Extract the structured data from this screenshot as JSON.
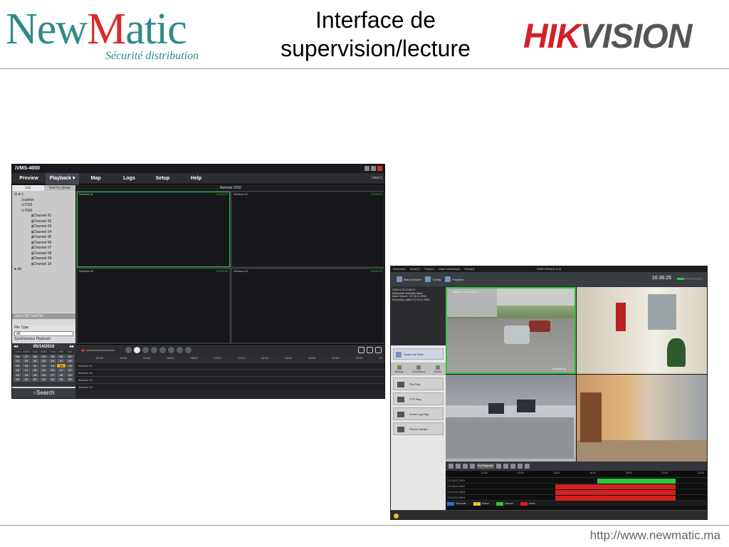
{
  "header": {
    "logo_main": "NewMatic",
    "logo_tagline": "Sécurité distribution",
    "title_line1": "Interface de",
    "title_line2": "supervision/lecture",
    "brand_logo": "HIKVISION"
  },
  "footer": {
    "url": "http://www.newmatic.ma"
  },
  "shot1": {
    "app_title": "iVMS-4000",
    "menu": [
      "Preview",
      "Playback",
      "Map",
      "Logs",
      "Setup",
      "Help"
    ],
    "user": "User:1",
    "tabs": [
      "List",
      "Sort by group"
    ],
    "tree": {
      "root": "Devices",
      "nodes": [
        "admin",
        "7016",
        "7600"
      ],
      "channels": [
        "Channel 01",
        "Channel 02",
        "Channel 03",
        "Channel 04",
        "Channel 05",
        "Channel 06",
        "Channel 07",
        "Channel 08",
        "Channel 09",
        "Channel 10"
      ],
      "extra": "dd"
    },
    "query_label": "Query By Card No",
    "file_type_label": "File Type",
    "file_type_value": "All",
    "sync_label": "Synchronous Playback",
    "calendar": {
      "date": "05/14/2010",
      "days": [
        "SUN",
        "MON",
        "TUE",
        "WED",
        "THU",
        "FRI",
        "SAT"
      ],
      "cells": [
        "26",
        "27",
        "28",
        "29",
        "30",
        "01",
        "01",
        "02",
        "03",
        "04",
        "05",
        "06",
        "07",
        "08",
        "09",
        "10",
        "11",
        "12",
        "13",
        "14",
        "15",
        "16",
        "17",
        "18",
        "19",
        "20",
        "21",
        "22",
        "23",
        "24",
        "25",
        "26",
        "27",
        "28",
        "29",
        "30",
        "31",
        "01",
        "02",
        "03",
        "04",
        "05"
      ],
      "selected": "14"
    },
    "search_label": "Search",
    "header_label": "Remote VOD",
    "windows": [
      {
        "label": "Window 01",
        "time": "00:00:00"
      },
      {
        "label": "Window 02",
        "time": "00:00:00"
      },
      {
        "label": "Window 03",
        "time": "00:00:00"
      },
      {
        "label": "Window 04",
        "time": "00:00:00"
      }
    ],
    "ticks": [
      "00:00",
      "02:00",
      "04:00",
      "06:00",
      "08:00",
      "10:00",
      "12:00",
      "14:00",
      "16:00",
      "18:00",
      "20:00",
      "22:00",
      "00"
    ],
    "rows": [
      "Window 01",
      "Window 02",
      "Window 03",
      "Window 04"
    ]
  },
  "shot2": {
    "title": "iVMS-2000(V1.0.3)",
    "menu": [
      "Device(D)",
      "View(V)",
      "Tools(T)",
      "Alarm window(A)",
      "Help(H)"
    ],
    "toolbar": [
      "Main Console",
      "Config",
      "Playback"
    ],
    "clock": "10:36:25",
    "alarm_lines": [
      "2009-11-24 10:35:31",
      "Distribution Detection Alarm",
      "Alarm Source: 172.16.11.239/1",
      "Recording Lattice:172.16.11.239/1"
    ],
    "search_by_time": "Search by Time",
    "panel_tabs": [
      "Backup",
      "Surveillance",
      "Device"
    ],
    "panel_buttons": [
      "File Play",
      "FTP Play",
      "Event Log Play",
      "Picture Viewer"
    ],
    "cameras": [
      {
        "time": "2009-11-24 10:35:31",
        "name": "Camera 01"
      },
      {
        "time": "",
        "name": ""
      },
      {
        "time": "",
        "name": ""
      },
      {
        "time": "",
        "name": ""
      }
    ],
    "playback_mode": "Full Playback",
    "tl_ticks": [
      "10:00",
      "12:00",
      "14:00",
      "16:00",
      "18:00",
      "20:00",
      "22:00"
    ],
    "tl_rows": [
      "172.16.11.239/1",
      "172.16.11.239/2",
      "172.16.11.239/3",
      "172.16.11.239/4"
    ],
    "legend": [
      {
        "label": "Schedule",
        "color": "#2e6fd8"
      },
      {
        "label": "Motion",
        "color": "#e6c229"
      },
      {
        "label": "Manual",
        "color": "#2ec53e"
      },
      {
        "label": "Alarm",
        "color": "#d42020"
      }
    ]
  }
}
